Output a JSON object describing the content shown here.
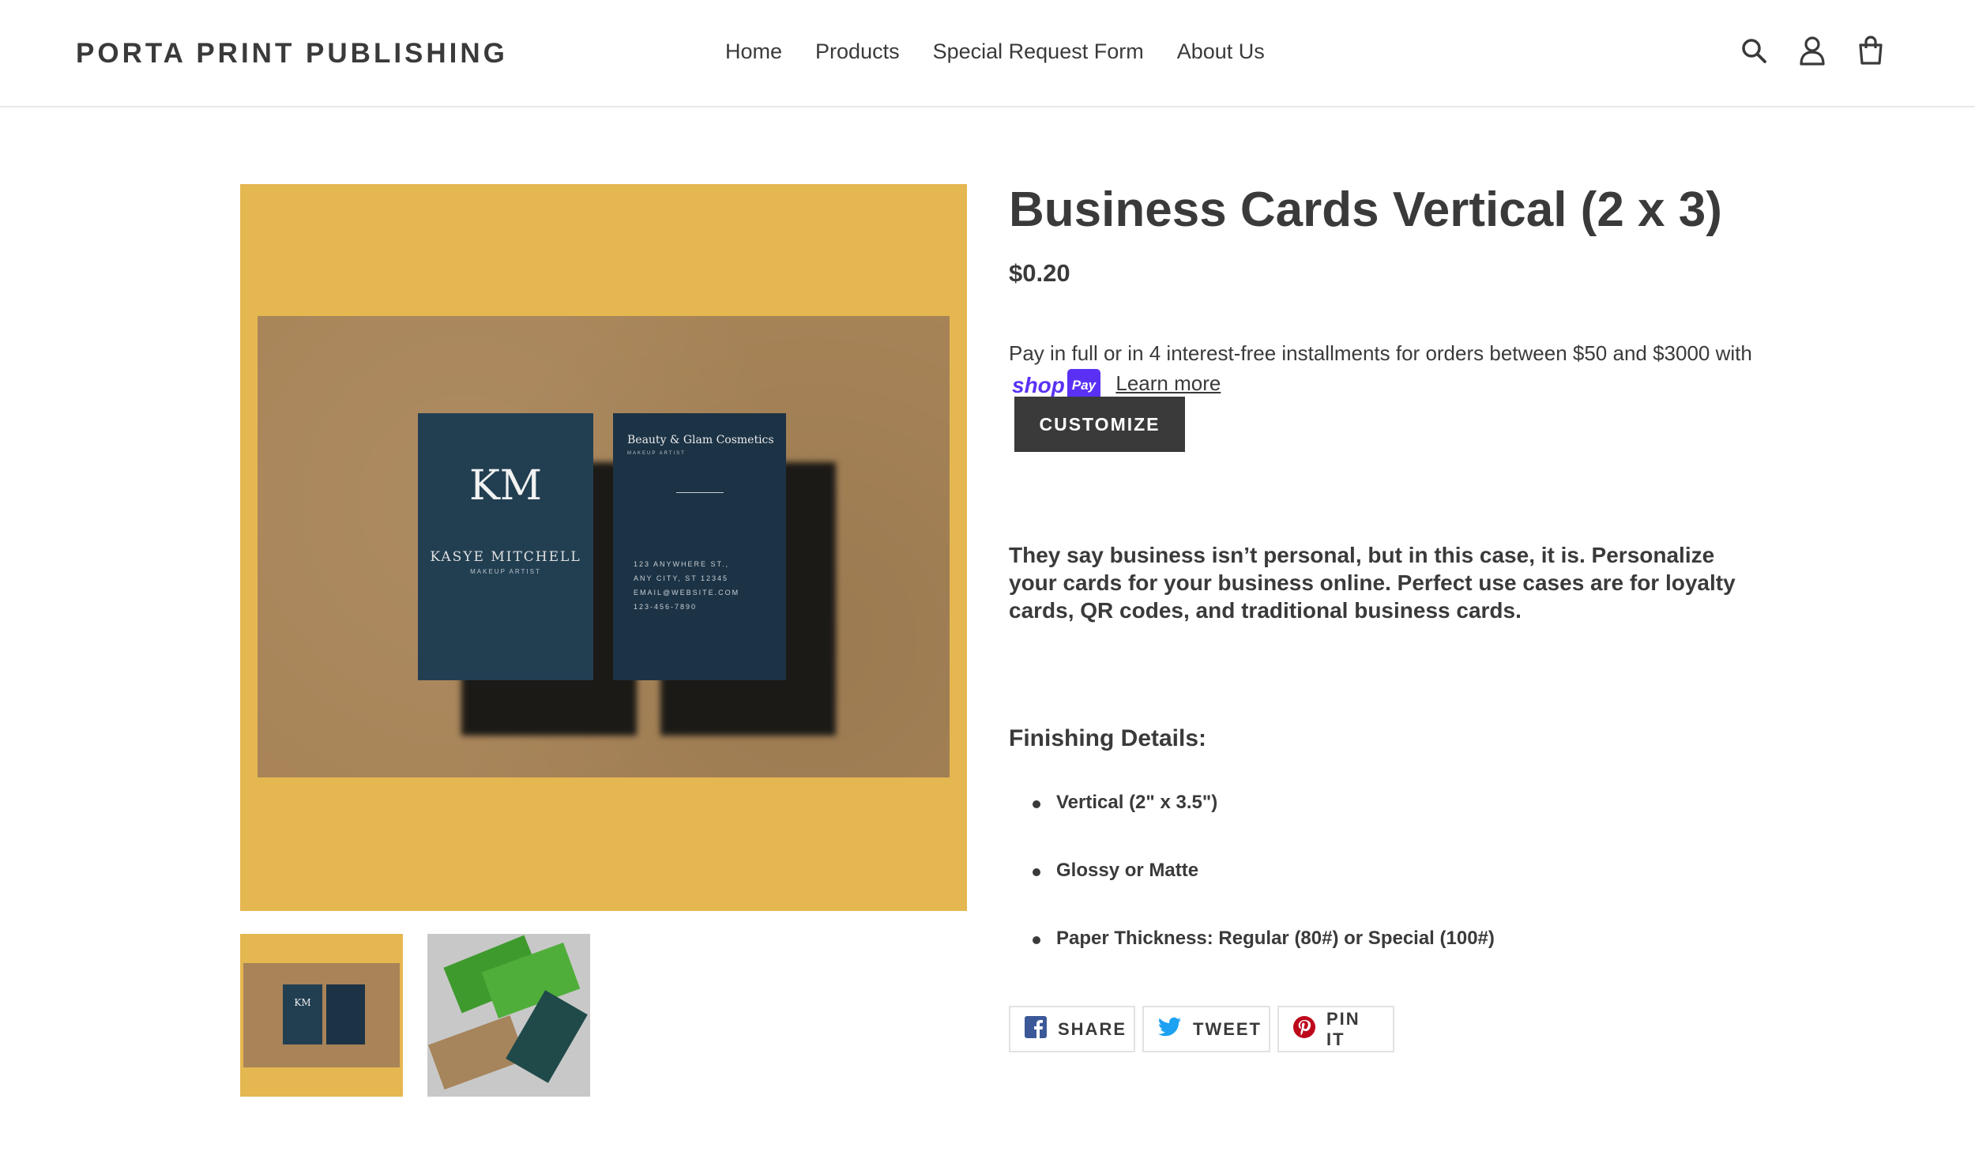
{
  "header": {
    "logo": "PORTA PRINT PUBLISHING",
    "nav": [
      "Home",
      "Products",
      "Special Request Form",
      "About Us"
    ],
    "icons": [
      "search-icon",
      "account-icon",
      "cart-icon"
    ]
  },
  "gallery": {
    "main_card_front": {
      "monogram": "KM",
      "name": "KASYE MITCHELL",
      "role": "MAKEUP ARTIST"
    },
    "main_card_back": {
      "brand": "Beauty & Glam Cosmetics",
      "role": "MAKEUP ARTIST",
      "address_lines": [
        "123 ANYWHERE ST.,",
        "ANY CITY, ST 12345",
        "EMAIL@WEBSITE.COM",
        "123-456-7890"
      ]
    },
    "thumb1_monogram": "KM"
  },
  "product": {
    "title": "Business Cards Vertical (2 x 3)",
    "price": "$0.20",
    "installments_text": "Pay in full or in 4 interest-free installments for orders between $50 and $3000 with",
    "shop_word": "shop",
    "pay_word": "Pay",
    "learn_more": "Learn more",
    "customize_label": "CUSTOMIZE",
    "description": "They say business isn’t personal, but in this case, it is. Personalize your cards for your business online. Perfect use cases are for loyalty cards, QR codes, and traditional business cards.",
    "finishing_heading": "Finishing Details:",
    "finishing_items": [
      "Vertical (2\" x 3.5\")",
      "Glossy or Matte",
      "Paper Thickness: Regular (80#) or Special (100#)"
    ]
  },
  "share": {
    "facebook": "SHARE",
    "twitter": "TWEET",
    "pinterest": "PIN IT"
  },
  "colors": {
    "accent": "#3a3a3a",
    "shop_pay": "#5a31f4",
    "gallery_bg": "#e5b750",
    "facebook": "#3b5998",
    "twitter": "#1da1f2",
    "pinterest": "#bd081c"
  }
}
